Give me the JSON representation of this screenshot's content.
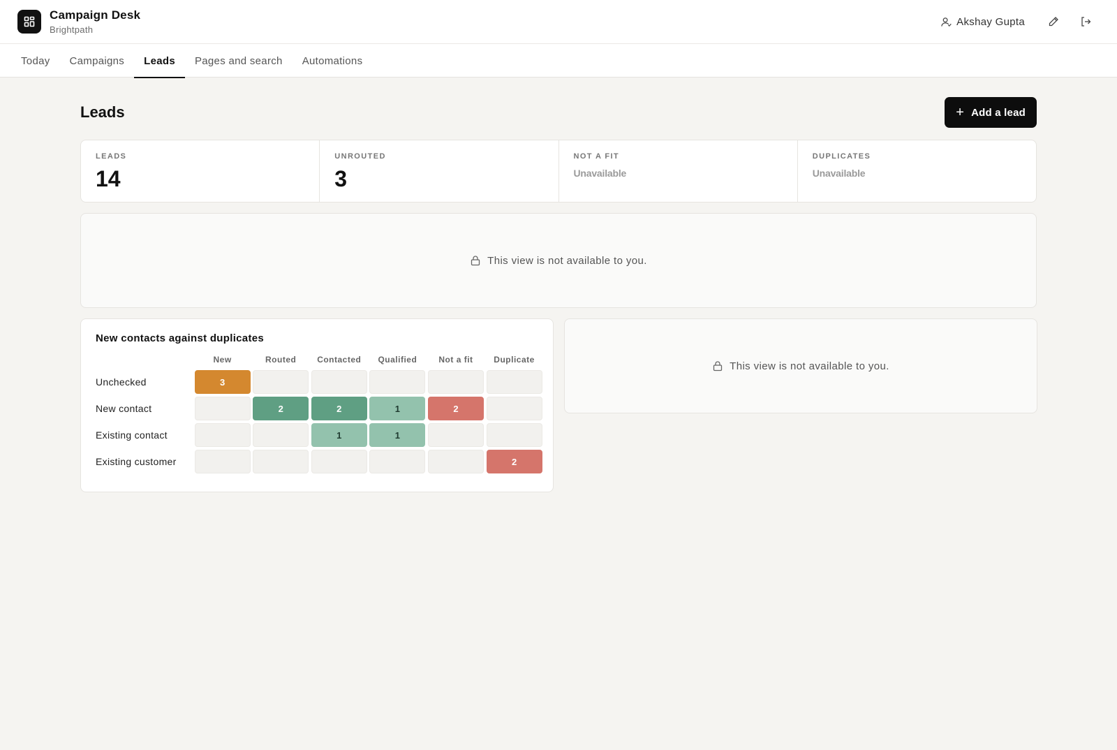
{
  "app": {
    "title": "Campaign Desk",
    "subtitle": "Brightpath",
    "logo_icon": "grid-icon"
  },
  "user": {
    "name": "Akshay Gupta",
    "icon": "user-icon"
  },
  "header_actions": [
    {
      "name": "edit-icon"
    },
    {
      "name": "logout-icon"
    }
  ],
  "tabs": [
    {
      "label": "Today",
      "active": false
    },
    {
      "label": "Campaigns",
      "active": false
    },
    {
      "label": "Leads",
      "active": true
    },
    {
      "label": "Pages and search",
      "active": false
    },
    {
      "label": "Automations",
      "active": false
    }
  ],
  "page": {
    "title": "Leads",
    "add_button": "Add a lead"
  },
  "stats": [
    {
      "label": "LEADS",
      "value": "14",
      "available": true
    },
    {
      "label": "UNROUTED",
      "value": "3",
      "available": true
    },
    {
      "label": "NOT A FIT",
      "value": "Unavailable",
      "available": false
    },
    {
      "label": "DUPLICATES",
      "value": "Unavailable",
      "available": false
    }
  ],
  "locked_message": "This view is not available to you.",
  "matrix": {
    "title": "New contacts against duplicates",
    "columns": [
      "New",
      "Routed",
      "Contacted",
      "Qualified",
      "Not a fit",
      "Duplicate"
    ],
    "rows": [
      {
        "label": "Unchecked",
        "values": [
          3,
          null,
          null,
          null,
          null,
          null
        ]
      },
      {
        "label": "New contact",
        "values": [
          null,
          2,
          2,
          1,
          2,
          null
        ]
      },
      {
        "label": "Existing contact",
        "values": [
          null,
          null,
          1,
          1,
          null,
          null
        ]
      },
      {
        "label": "Existing customer",
        "values": [
          null,
          null,
          null,
          null,
          null,
          2
        ]
      }
    ],
    "column_colors": {
      "New": "#d4882f",
      "Routed": "#5f9f83",
      "Contacted": "#5f9f83",
      "Qualified": "#93c2ad",
      "Not a fit": "#d5756b",
      "Duplicate": "#d5756b"
    },
    "contacted_light_color": "#93c2ad",
    "empty_color": "#f2f1ee"
  }
}
